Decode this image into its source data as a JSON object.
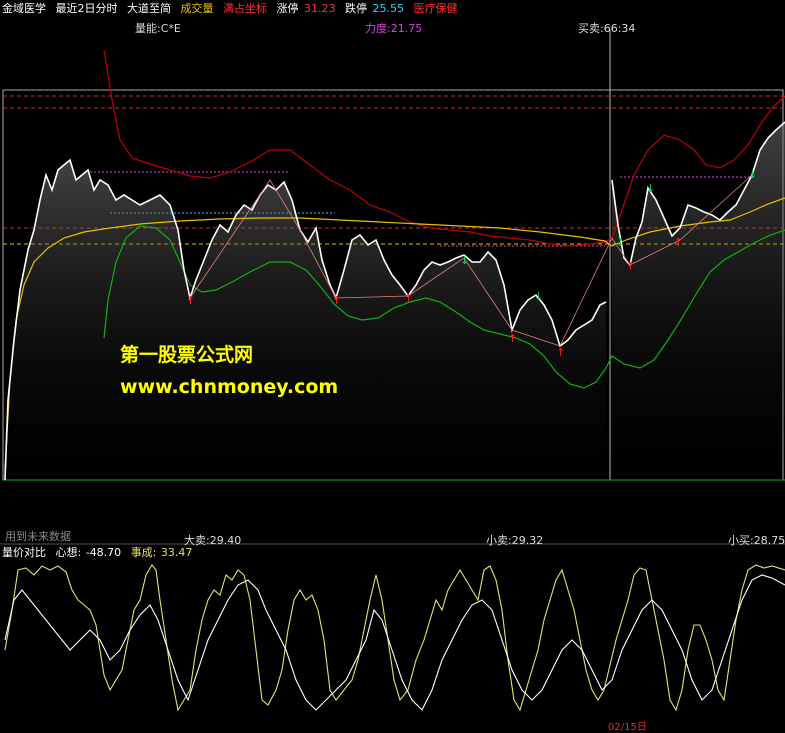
{
  "top_bar": {
    "stock_name": "金域医学",
    "period": "最近2日分时",
    "indicator": "大道至简",
    "volume_label": "成交量",
    "coord_label": "满占坐标",
    "limit_up_label": "涨停",
    "limit_up_value": "31.23",
    "limit_down_label": "跌停",
    "limit_down_value": "25.55",
    "sector": "医疗保健"
  },
  "main_panel": {
    "volume_energy": "量能:C*E",
    "strength": "力度:21.75",
    "buy_sell": "买卖:66:34",
    "future_data_note": "用到未来数据",
    "big_sell": "大卖:29.40",
    "small_sell_1": "小卖:29.32",
    "small_buy": "小买:28.75"
  },
  "oscillator": {
    "name": "量价对比",
    "mind_label": "心想:",
    "mind_value": "-48.70",
    "done_label": "事成:",
    "done_value": "33.47"
  },
  "bottom_partial": "02/15日",
  "watermark": {
    "line1": "第一股票公式网",
    "line2": "www.chnmoney.com"
  },
  "colors": {
    "price": "#ffffff",
    "ma_yellow": "#e8c000",
    "ma_red": "#c00000",
    "ma_green": "#10b010",
    "accent_magenta": "#e040e0",
    "accent_cyan": "#40c0e0",
    "osc_yellow": "#e8e070"
  }
}
